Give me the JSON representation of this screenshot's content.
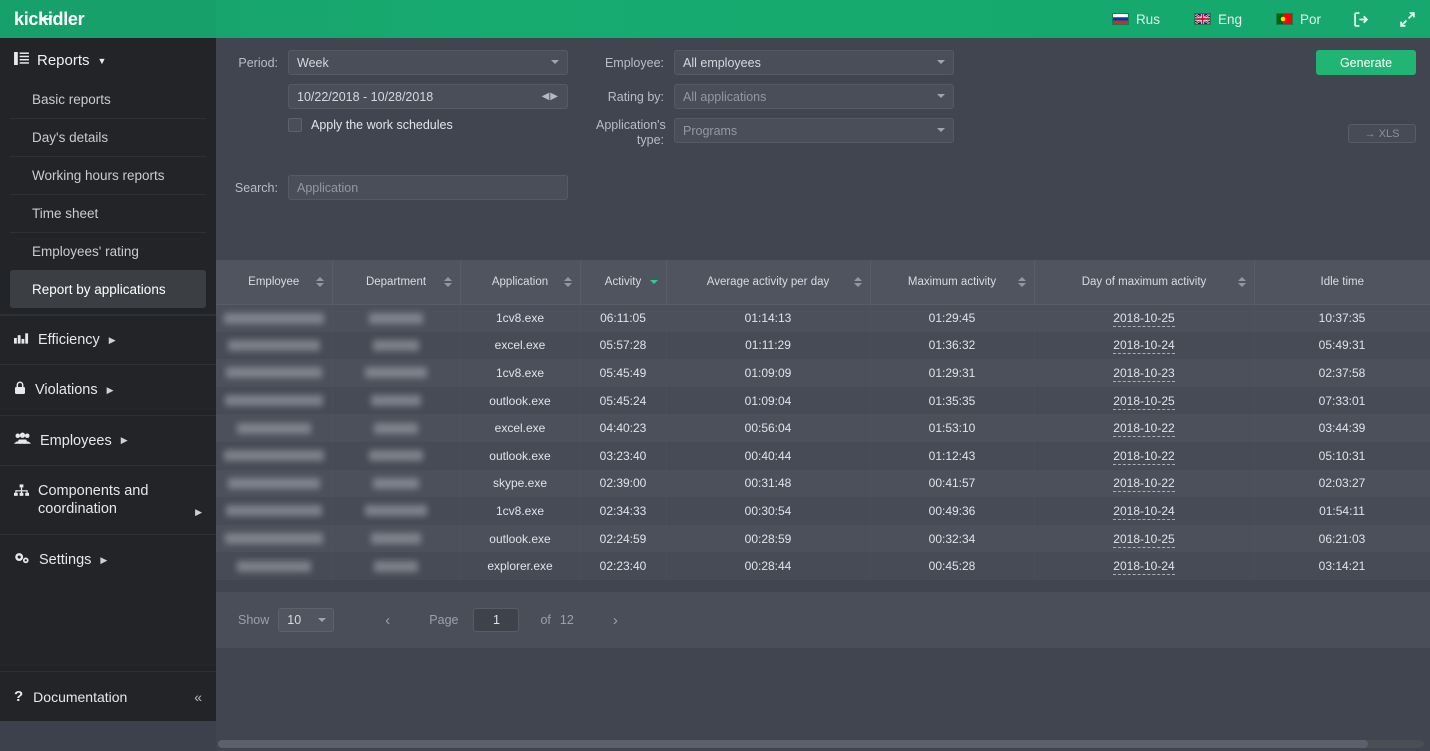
{
  "topbar": {
    "logo": "kickidler",
    "languages": [
      {
        "code": "rus",
        "label": "Rus",
        "flag": "russia-flag-icon"
      },
      {
        "code": "eng",
        "label": "Eng",
        "flag": "uk-flag-icon"
      },
      {
        "code": "por",
        "label": "Por",
        "flag": "portugal-flag-icon"
      }
    ],
    "logout_icon": "logout-icon",
    "fullscreen_icon": "fullscreen-icon"
  },
  "sidebar": {
    "reports": {
      "label": "Reports",
      "icon": "list-icon",
      "items": [
        {
          "label": "Basic reports",
          "active": false
        },
        {
          "label": "Day's details",
          "active": false
        },
        {
          "label": "Working hours reports",
          "active": false
        },
        {
          "label": "Time sheet",
          "active": false
        },
        {
          "label": "Employees' rating",
          "active": false
        },
        {
          "label": "Report by applications",
          "active": true
        }
      ]
    },
    "groups": [
      {
        "label": "Efficiency",
        "icon": "chart-icon"
      },
      {
        "label": "Violations",
        "icon": "lock-icon"
      },
      {
        "label": "Employees",
        "icon": "users-icon"
      },
      {
        "label": "Components and coordination",
        "icon": "sitemap-icon"
      },
      {
        "label": "Settings",
        "icon": "gears-icon"
      }
    ],
    "documentation": {
      "label": "Documentation",
      "icon": "question-icon",
      "collapse_icon": "collapse-left-icon"
    }
  },
  "filters": {
    "period_label": "Period:",
    "period_value": "Week",
    "date_range": "10/22/2018 - 10/28/2018",
    "apply_schedules_label": "Apply the work schedules",
    "apply_schedules_checked": false,
    "search_label": "Search:",
    "search_placeholder": "Application",
    "search_value": "",
    "employee_label": "Employee:",
    "employee_value": "All employees",
    "rating_by_label": "Rating by:",
    "rating_by_value": "All applications",
    "app_type_label": "Application's type:",
    "app_type_value": "Programs",
    "generate_button": "Generate",
    "xls_button": "→ XLS"
  },
  "table": {
    "columns": [
      {
        "label": "Employee",
        "sorted": false
      },
      {
        "label": "Department",
        "sorted": false
      },
      {
        "label": "Application",
        "sorted": false
      },
      {
        "label": "Activity",
        "sorted": true
      },
      {
        "label": "Average activity per day",
        "sorted": false
      },
      {
        "label": "Maximum activity",
        "sorted": false
      },
      {
        "label": "Day of maximum activity",
        "sorted": false
      },
      {
        "label": "Idle time",
        "sorted": false
      }
    ],
    "rows": [
      {
        "employee": "",
        "department": "",
        "application": "1cv8.exe",
        "activity": "06:11:05",
        "avg_activity": "01:14:13",
        "max_activity": "01:29:45",
        "max_day": "2018-10-25",
        "idle": "10:37:35"
      },
      {
        "employee": "",
        "department": "",
        "application": "excel.exe",
        "activity": "05:57:28",
        "avg_activity": "01:11:29",
        "max_activity": "01:36:32",
        "max_day": "2018-10-24",
        "idle": "05:49:31"
      },
      {
        "employee": "",
        "department": "",
        "application": "1cv8.exe",
        "activity": "05:45:49",
        "avg_activity": "01:09:09",
        "max_activity": "01:29:31",
        "max_day": "2018-10-23",
        "idle": "02:37:58"
      },
      {
        "employee": "",
        "department": "",
        "application": "outlook.exe",
        "activity": "05:45:24",
        "avg_activity": "01:09:04",
        "max_activity": "01:35:35",
        "max_day": "2018-10-25",
        "idle": "07:33:01"
      },
      {
        "employee": "",
        "department": "",
        "application": "excel.exe",
        "activity": "04:40:23",
        "avg_activity": "00:56:04",
        "max_activity": "01:53:10",
        "max_day": "2018-10-22",
        "idle": "03:44:39"
      },
      {
        "employee": "",
        "department": "",
        "application": "outlook.exe",
        "activity": "03:23:40",
        "avg_activity": "00:40:44",
        "max_activity": "01:12:43",
        "max_day": "2018-10-22",
        "idle": "05:10:31"
      },
      {
        "employee": "",
        "department": "",
        "application": "skype.exe",
        "activity": "02:39:00",
        "avg_activity": "00:31:48",
        "max_activity": "00:41:57",
        "max_day": "2018-10-22",
        "idle": "02:03:27"
      },
      {
        "employee": "",
        "department": "",
        "application": "1cv8.exe",
        "activity": "02:34:33",
        "avg_activity": "00:30:54",
        "max_activity": "00:49:36",
        "max_day": "2018-10-24",
        "idle": "01:54:11"
      },
      {
        "employee": "",
        "department": "",
        "application": "outlook.exe",
        "activity": "02:24:59",
        "avg_activity": "00:28:59",
        "max_activity": "00:32:34",
        "max_day": "2018-10-25",
        "idle": "06:21:03"
      },
      {
        "employee": "",
        "department": "",
        "application": "explorer.exe",
        "activity": "02:23:40",
        "avg_activity": "00:28:44",
        "max_activity": "00:45:28",
        "max_day": "2018-10-24",
        "idle": "03:14:21"
      }
    ]
  },
  "pagination": {
    "show_label": "Show",
    "show_value": "10",
    "prev_icon": "‹",
    "page_label": "Page",
    "page_value": "1",
    "of_label": "of",
    "total_pages": "12",
    "next_icon": "›"
  },
  "colors": {
    "accent_green": "#21b573",
    "topbar_green": "#17a069",
    "sidebar_dark": "#222427",
    "panel": "#41454f",
    "table_header": "#50545e"
  }
}
